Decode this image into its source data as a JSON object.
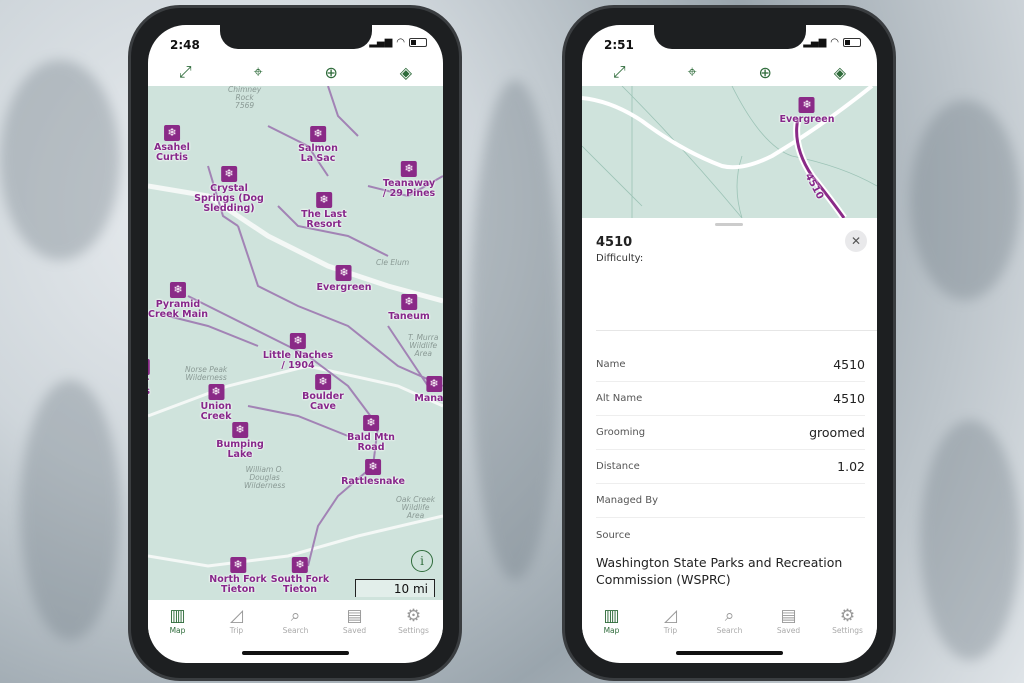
{
  "left_phone": {
    "status": {
      "time": "2:48"
    },
    "toolbar": {
      "icons": [
        "expand-icon",
        "locate-icon",
        "add-icon",
        "layers-icon"
      ]
    },
    "map": {
      "markers": [
        "Asahel\nCurtis",
        "Salmon\nLa Sac",
        "Teanaway\n/ 29 Pines",
        "Crystal\nSprings (Dog\nSledding)",
        "The Last\nResort",
        "Evergreen",
        "Pyramid\nCreek Main",
        "Taneum",
        "Little Naches\n/ 1904",
        "Boulder\nCave",
        "Union\nCreek",
        "Manast",
        "Bumping\nLake",
        "Bald Mtn\nRoad",
        "Rattlesnake",
        "North Fork\nTieton",
        "South Fork\nTieton",
        "ver\nngs"
      ],
      "place_labels": [
        "Chimney\nRock\n7569",
        "Cle Elum",
        "T. Murra\nWildlife\nArea",
        "Norse Peak\nWilderness",
        "William O.\nDouglas\nWilderness",
        "Oak Creek\nWildlife\nArea"
      ],
      "scale": "10 mi"
    },
    "tabs": [
      {
        "label": "Map",
        "active": true
      },
      {
        "label": "Trip"
      },
      {
        "label": "Search"
      },
      {
        "label": "Saved"
      },
      {
        "label": "Settings"
      }
    ]
  },
  "right_phone": {
    "status": {
      "time": "2:51"
    },
    "map": {
      "marker": "Evergreen",
      "trail_label": "4510"
    },
    "sheet": {
      "title": "4510",
      "difficulty": "Difficulty:",
      "rows": [
        {
          "k": "Name",
          "v": "4510"
        },
        {
          "k": "Alt Name",
          "v": "4510"
        },
        {
          "k": "Grooming",
          "v": "groomed"
        },
        {
          "k": "Distance",
          "v": "1.02"
        },
        {
          "k": "Managed By",
          "v": ""
        },
        {
          "k": "Source",
          "v": ""
        }
      ],
      "source_value": "Washington State Parks and Recreation Commission (WSPRC)"
    },
    "tabs": [
      {
        "label": "Map",
        "active": true
      },
      {
        "label": "Trip"
      },
      {
        "label": "Search"
      },
      {
        "label": "Saved"
      },
      {
        "label": "Settings"
      }
    ]
  },
  "colors": {
    "accent": "#2e6b3a",
    "marker": "#8a2a87",
    "map": "#cfe3dc"
  }
}
